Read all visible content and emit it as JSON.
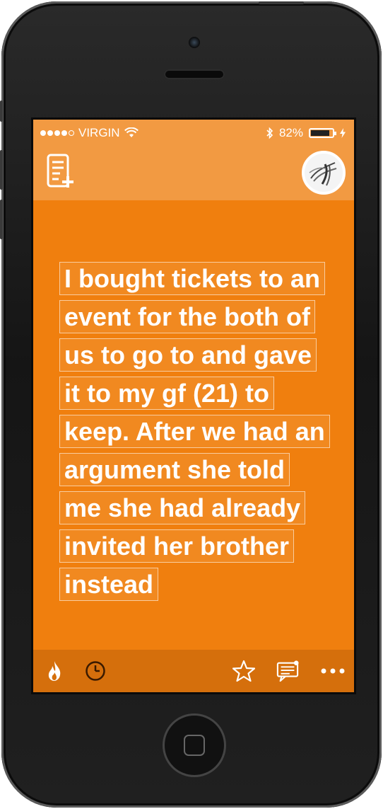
{
  "status_bar": {
    "carrier": "VIRGIN",
    "signal_filled": 4,
    "signal_total": 5,
    "battery_percent": "82%",
    "battery_level": 0.82
  },
  "nav": {
    "compose_icon": "compose-note-icon",
    "avatar_icon": "profile-avatar"
  },
  "post": {
    "text": "I bought tickets to an event for the both of us to go to and gave it to my gf (21) to keep. After we had an argument she told me she had already invited her brother instead"
  },
  "toolbar": {
    "icons": [
      "flame-icon",
      "clock-icon",
      "star-icon",
      "comments-icon",
      "more-icon"
    ]
  },
  "colors": {
    "background": "#f07f0e",
    "header": "#f29a42",
    "toolbar": "#d56f0c",
    "text": "#ffffff"
  }
}
